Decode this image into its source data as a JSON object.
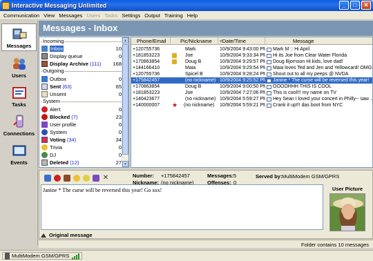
{
  "window": {
    "title": "Interactive Messaging Unlimited"
  },
  "menu": [
    {
      "label": "Communication",
      "enabled": true
    },
    {
      "label": "View",
      "enabled": true
    },
    {
      "label": "Messages",
      "enabled": true
    },
    {
      "label": "Users",
      "enabled": false
    },
    {
      "label": "Tasks",
      "enabled": false
    },
    {
      "label": "Settings",
      "enabled": true
    },
    {
      "label": "Output",
      "enabled": true
    },
    {
      "label": "Training",
      "enabled": true
    },
    {
      "label": "Help",
      "enabled": true
    }
  ],
  "nav": [
    {
      "label": "Messages",
      "icon": "messages-icon",
      "active": true
    },
    {
      "label": "Users",
      "icon": "users-icon",
      "active": false
    },
    {
      "label": "Tasks",
      "icon": "tasks-icon",
      "active": false
    },
    {
      "label": "Connections",
      "icon": "connections-icon",
      "active": false
    },
    {
      "label": "Events",
      "icon": "events-icon",
      "active": false
    }
  ],
  "pane": {
    "title": "Messages - Inbox"
  },
  "folders": {
    "groups": [
      "Incoming",
      "Outgoing",
      "System"
    ],
    "items": [
      {
        "name": "Inbox",
        "unread": "",
        "count": "10",
        "bold": false,
        "selected": true,
        "icon": "inbox-icon"
      },
      {
        "name": "Display queue",
        "unread": "",
        "count": "0",
        "bold": false,
        "icon": "display-queue-icon"
      },
      {
        "name": "Display Archive",
        "unread": "(111)",
        "count": "168",
        "bold": true,
        "icon": "display-archive-icon"
      },
      {
        "name": "Outbox",
        "unread": "",
        "count": "0",
        "bold": false,
        "icon": "outbox-icon"
      },
      {
        "name": "Sent",
        "unread": "(63)",
        "count": "65",
        "bold": true,
        "icon": "sent-icon"
      },
      {
        "name": "Unsent",
        "unread": "",
        "count": "0",
        "bold": false,
        "icon": "unsent-icon"
      },
      {
        "name": "Alert",
        "unread": "",
        "count": "0",
        "bold": false,
        "icon": "alert-icon"
      },
      {
        "name": "Blocked",
        "unread": "(7)",
        "count": "23",
        "bold": true,
        "icon": "blocked-icon"
      },
      {
        "name": "User profile",
        "unread": "",
        "count": "0",
        "bold": false,
        "icon": "user-profile-icon"
      },
      {
        "name": "System",
        "unread": "",
        "count": "0",
        "bold": false,
        "icon": "system-icon"
      },
      {
        "name": "Voting",
        "unread": "(34)",
        "count": "34",
        "bold": true,
        "icon": "voting-icon"
      },
      {
        "name": "Trivia",
        "unread": "",
        "count": "0",
        "bold": false,
        "icon": "trivia-icon"
      },
      {
        "name": "DJ",
        "unread": "",
        "count": "0",
        "bold": false,
        "icon": "dj-icon"
      },
      {
        "name": "Deleted",
        "unread": "(12)",
        "count": "27",
        "bold": true,
        "icon": "deleted-icon"
      }
    ]
  },
  "messages": {
    "columns": [
      "Phone/Email",
      "Pic/Nickname",
      "Date/Time",
      "Message"
    ],
    "rows": [
      {
        "phone": "+120755736",
        "nick": "Mark",
        "date": "10/9/2004 9:43:00 PM",
        "msg": "Mark M :: Hi April",
        "icon": ""
      },
      {
        "phone": "+181853223",
        "nick": "Joe",
        "date": "10/9/2004 9:33:34 PM",
        "msg": "Hi its Joe from Clear Water Florida",
        "icon": "trophy-icon"
      },
      {
        "phone": "+170863854",
        "nick": "Doug B",
        "date": "10/9/2004 9:29:57 PM",
        "msg": "Doug Bjornson Hi kids, love dad!",
        "icon": "trophy-icon"
      },
      {
        "phone": "+144166410",
        "nick": "Maia",
        "date": "10/9/2004 9:29:54 PM",
        "msg": "Maia loves Ted and Jen and Yellowcard! OMG!",
        "icon": ""
      },
      {
        "phone": "+120755736",
        "nick": "Spicel B",
        "date": "10/9/2004 9:28:24 PM",
        "msg": "Shout out to all my peeps @ NVDA",
        "icon": ""
      },
      {
        "phone": "+175842457",
        "nick": "(no nickname)",
        "date": "10/9/2004 9:25:52 PM",
        "msg": "Janine * The curse will be reversed this year!",
        "icon": "",
        "selected": true
      },
      {
        "phone": "+170863854",
        "nick": "Doug B",
        "date": "10/9/2004 9:00:50 PM",
        "msg": "OOOOHHH THIS IS COOL",
        "icon": ""
      },
      {
        "phone": "+181853223",
        "nick": "Joe",
        "date": "10/9/2004 7:27:06 PM",
        "msg": "This is cool!!! my name on TV",
        "icon": ""
      },
      {
        "phone": "+140423677",
        "nick": "(no nickname)",
        "date": "10/9/2004 5:59:27 PM",
        "msg": "Hey Sean I loved your concert in Philly-- saw ...",
        "icon": ""
      },
      {
        "phone": "+140000007",
        "nick": "(no nickname)",
        "date": "10/9/2004 5:59:21 PM",
        "msg": "Crank it up!!!   das boot from NYC",
        "icon": "star-icon"
      }
    ]
  },
  "detail": {
    "number_label": "Number:",
    "number_value": "+175842457",
    "nickname_label": "Nickname:",
    "nickname_value": "(no nickname)",
    "messages_label": "Messages:",
    "messages_value": "5",
    "offenses_label": "Offenses:",
    "offenses_value": "0",
    "served_label": "Served by:",
    "served_value": "MultiModem GSM/GPRS",
    "message_text": "Janine * The curse will be reversed this year! Go sox!",
    "user_picture_label": "User Picture",
    "original_message_label": "Original message"
  },
  "status": {
    "folder_info": "Folder contains 10 messages",
    "modem": "MultiModem GSM/GPRS"
  },
  "colors": {
    "titlebar": "#0a5de8",
    "header": "#7a96b2",
    "selection": "#316ac5"
  }
}
